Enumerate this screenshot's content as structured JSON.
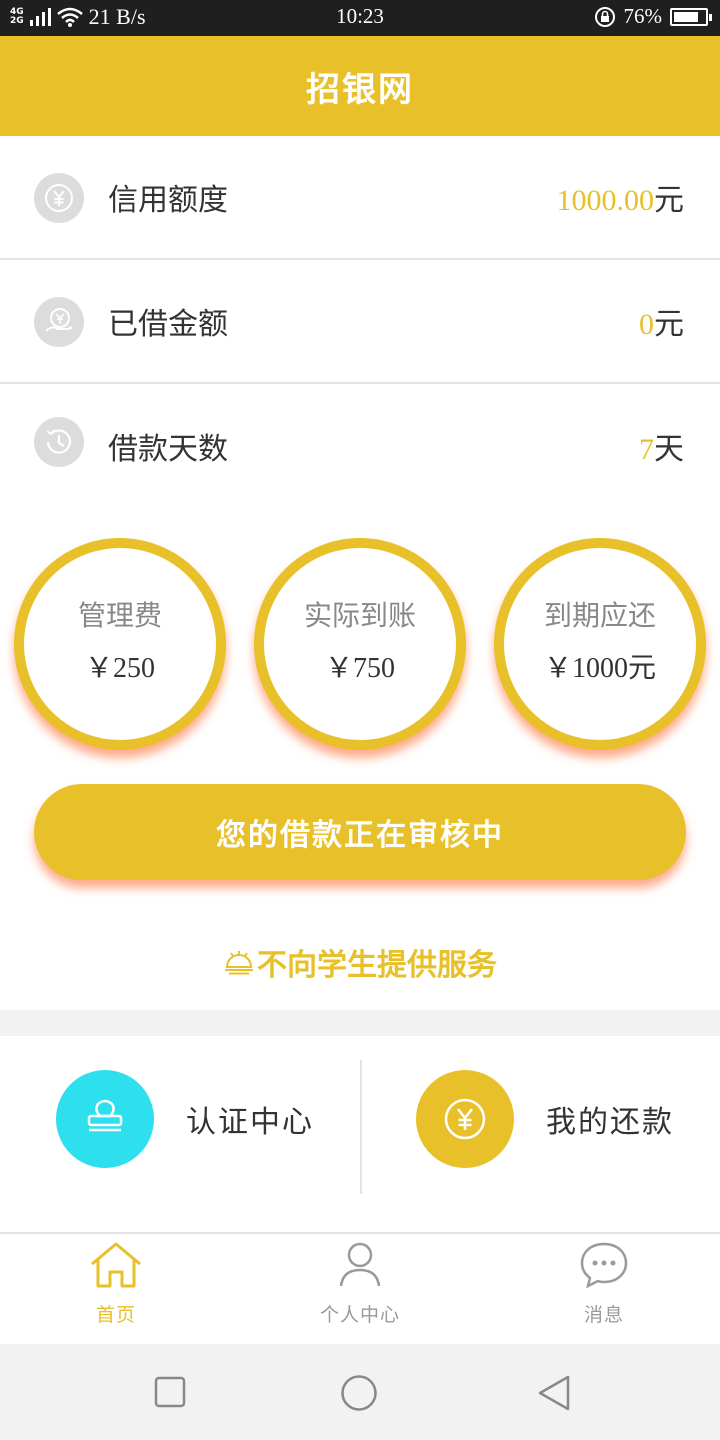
{
  "status_bar": {
    "network_top": "4G",
    "network_bottom": "2G",
    "speed": "21 B/s",
    "time": "10:23",
    "battery": "76%"
  },
  "header": {
    "title": "招银网"
  },
  "info_rows": [
    {
      "label": "信用额度",
      "value": "1000.00",
      "unit": "元",
      "icon": "yen-exchange-icon"
    },
    {
      "label": "已借金额",
      "value": "0",
      "unit": "元",
      "icon": "yen-hand-icon"
    },
    {
      "label": "借款天数",
      "value": "7",
      "unit": "天",
      "icon": "history-clock-icon"
    }
  ],
  "circles": [
    {
      "label": "管理费",
      "value": "￥250"
    },
    {
      "label": "实际到账",
      "value": "￥750"
    },
    {
      "label": "到期应还",
      "value": "￥1000元"
    }
  ],
  "review_button": "您的借款正在审核中",
  "notice": {
    "icon": "bell-icon",
    "text": "不向学生提供服务"
  },
  "entries": [
    {
      "label": "认证中心",
      "icon": "stamp-icon",
      "color": "#2ee0ee"
    },
    {
      "label": "我的还款",
      "icon": "yen-circle-icon",
      "color": "#e7c02a"
    }
  ],
  "bottom_nav": [
    {
      "label": "首页",
      "icon": "home-icon",
      "active": true
    },
    {
      "label": "个人中心",
      "icon": "person-icon",
      "active": false
    },
    {
      "label": "消息",
      "icon": "chat-bubble-icon",
      "active": false
    }
  ],
  "colors": {
    "accent": "#e7c02a",
    "cyan": "#2ee0ee",
    "inactive": "#9a9a9a"
  }
}
